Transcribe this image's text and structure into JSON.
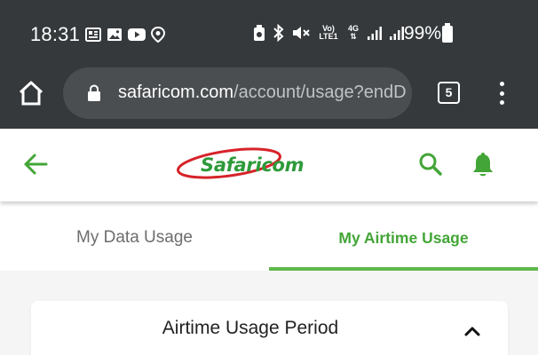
{
  "status_bar": {
    "time": "18:31",
    "battery_percent": "99%",
    "left_icons": [
      "news-icon",
      "image-icon",
      "youtube-icon",
      "location-icon"
    ],
    "right_icons": [
      "alarm-icon",
      "bluetooth-icon",
      "mute-icon",
      "volte-icon",
      "4g-icon",
      "signal-icon",
      "signal-icon",
      "battery-icon"
    ],
    "volte_label_top": "Vo)",
    "volte_label_bottom": "LTE1",
    "network_label": "4G"
  },
  "browser": {
    "url_domain": "safaricom.com",
    "url_path": "/account/usage?endD",
    "tab_count": "5"
  },
  "app_header": {
    "logo_text": "Safaricom",
    "brand_green": "#43a537",
    "brand_red": "#d6232a"
  },
  "tabs": [
    {
      "label": "My Data Usage",
      "active": false
    },
    {
      "label": "My Airtime Usage",
      "active": true
    }
  ],
  "card": {
    "title": "Airtime Usage Period",
    "expanded": true
  }
}
